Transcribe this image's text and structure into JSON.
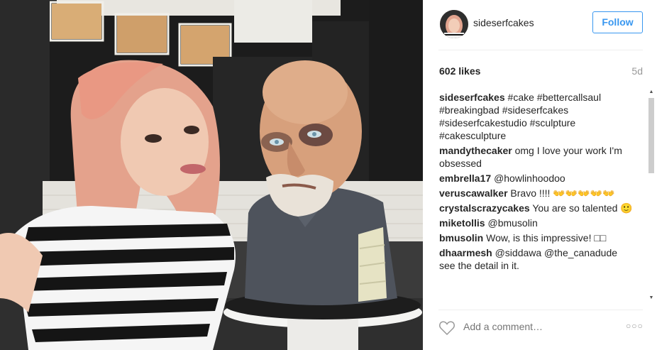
{
  "post": {
    "username": "sideserfcakes",
    "follow_label": "Follow",
    "likes": "602 likes",
    "age": "5d"
  },
  "comments": [
    {
      "user": "sideserfcakes",
      "text": "#cake #bettercallsaul #breakingbad #sideserfcakes #sideserfcakestudio #sculpture #cakesculpture",
      "highlight": true
    },
    {
      "user": "mandythecaker",
      "text": "omg I love your work I'm obsessed",
      "highlight": false
    },
    {
      "user": "embrella17",
      "text": "@howlinhoodoo",
      "highlight": true
    },
    {
      "user": "veruscawalker",
      "text": "Bravo !!!! 👐👐👐👐👐",
      "highlight": false
    },
    {
      "user": "crystalscrazycakes",
      "text": "You are so talented 🙂",
      "highlight": false
    },
    {
      "user": "miketollis",
      "text": "@bmusolin",
      "highlight": true
    },
    {
      "user": "bmusolin",
      "text": "Wow, is this impressive! □□",
      "highlight": false
    },
    {
      "user": "dhaarmesh",
      "text": "@siddawa @the_canadude",
      "highlight": true,
      "extra": "see the detail in it."
    }
  ],
  "input": {
    "placeholder": "Add a comment…"
  },
  "icons": {
    "heart": "heart-icon",
    "more": "more-options-icon",
    "scroll_up": "scroll-up-arrow-icon",
    "scroll_down": "scroll-down-arrow-icon"
  },
  "colors": {
    "accent": "#3897f0",
    "hashtag": "#003569",
    "muted": "#999999"
  }
}
